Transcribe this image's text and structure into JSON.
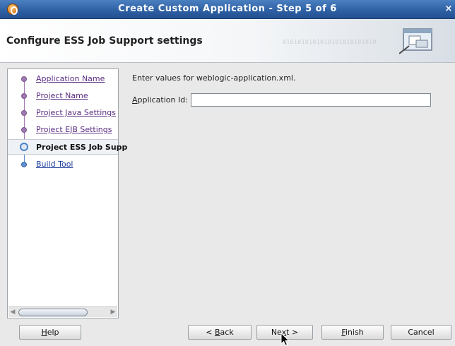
{
  "window": {
    "title": "Create Custom Application - Step 5 of 6",
    "close_glyph": "×"
  },
  "header": {
    "page_title": "Configure ESS Job Support settings",
    "decoration_text": "0101010101010101010101010"
  },
  "nav": {
    "items": [
      {
        "label": "Application Name",
        "state": "visited"
      },
      {
        "label": "Project Name",
        "state": "visited"
      },
      {
        "label": "Project Java Settings",
        "state": "visited"
      },
      {
        "label": "Project EJB Settings",
        "state": "visited"
      },
      {
        "label": "Project ESS Job Supp",
        "state": "current"
      },
      {
        "label": "Build Tool",
        "state": "future"
      }
    ]
  },
  "content": {
    "instructions": "Enter values for weblogic-application.xml.",
    "application_id": {
      "label_mnemonic": "A",
      "label_rest": "pplication Id:",
      "value": ""
    }
  },
  "buttons": {
    "help": {
      "mnemonic": "H",
      "rest": "elp"
    },
    "back": {
      "prefix": "< ",
      "mnemonic": "B",
      "rest": "ack"
    },
    "next": {
      "prefix": "Ne",
      "mnemonic": "x",
      "rest": "t >"
    },
    "finish": {
      "mnemonic": "F",
      "rest": "inish"
    },
    "cancel": {
      "label": "Cancel"
    }
  },
  "colors": {
    "titlebar": "#2d5fa3",
    "visited_link": "#5a2d82",
    "future_link": "#1f3f9f"
  }
}
